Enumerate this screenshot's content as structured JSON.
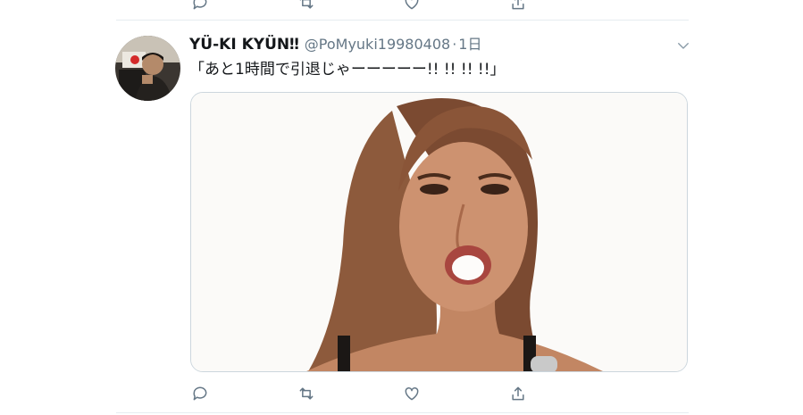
{
  "previous_tweet": {
    "actions": [
      "reply-icon",
      "retweet-icon",
      "like-icon",
      "share-icon"
    ]
  },
  "tweet": {
    "display_name": "YÜ-KI KYÜN‼",
    "handle": "@PoMyuki19980408",
    "separator": "·",
    "timestamp": "1日",
    "text": "「あと1時間で引退じゃーーーーー!! !! !! !!」",
    "menu_icon": "chevron-down-icon",
    "media": {
      "type": "photo",
      "description_icon": "photo"
    },
    "actions": [
      "reply-icon",
      "retweet-icon",
      "like-icon",
      "share-icon"
    ]
  },
  "colors": {
    "text_primary": "#14171a",
    "text_secondary": "#657786",
    "border": "#e6ecf0",
    "media_border": "#ccd6dd"
  }
}
